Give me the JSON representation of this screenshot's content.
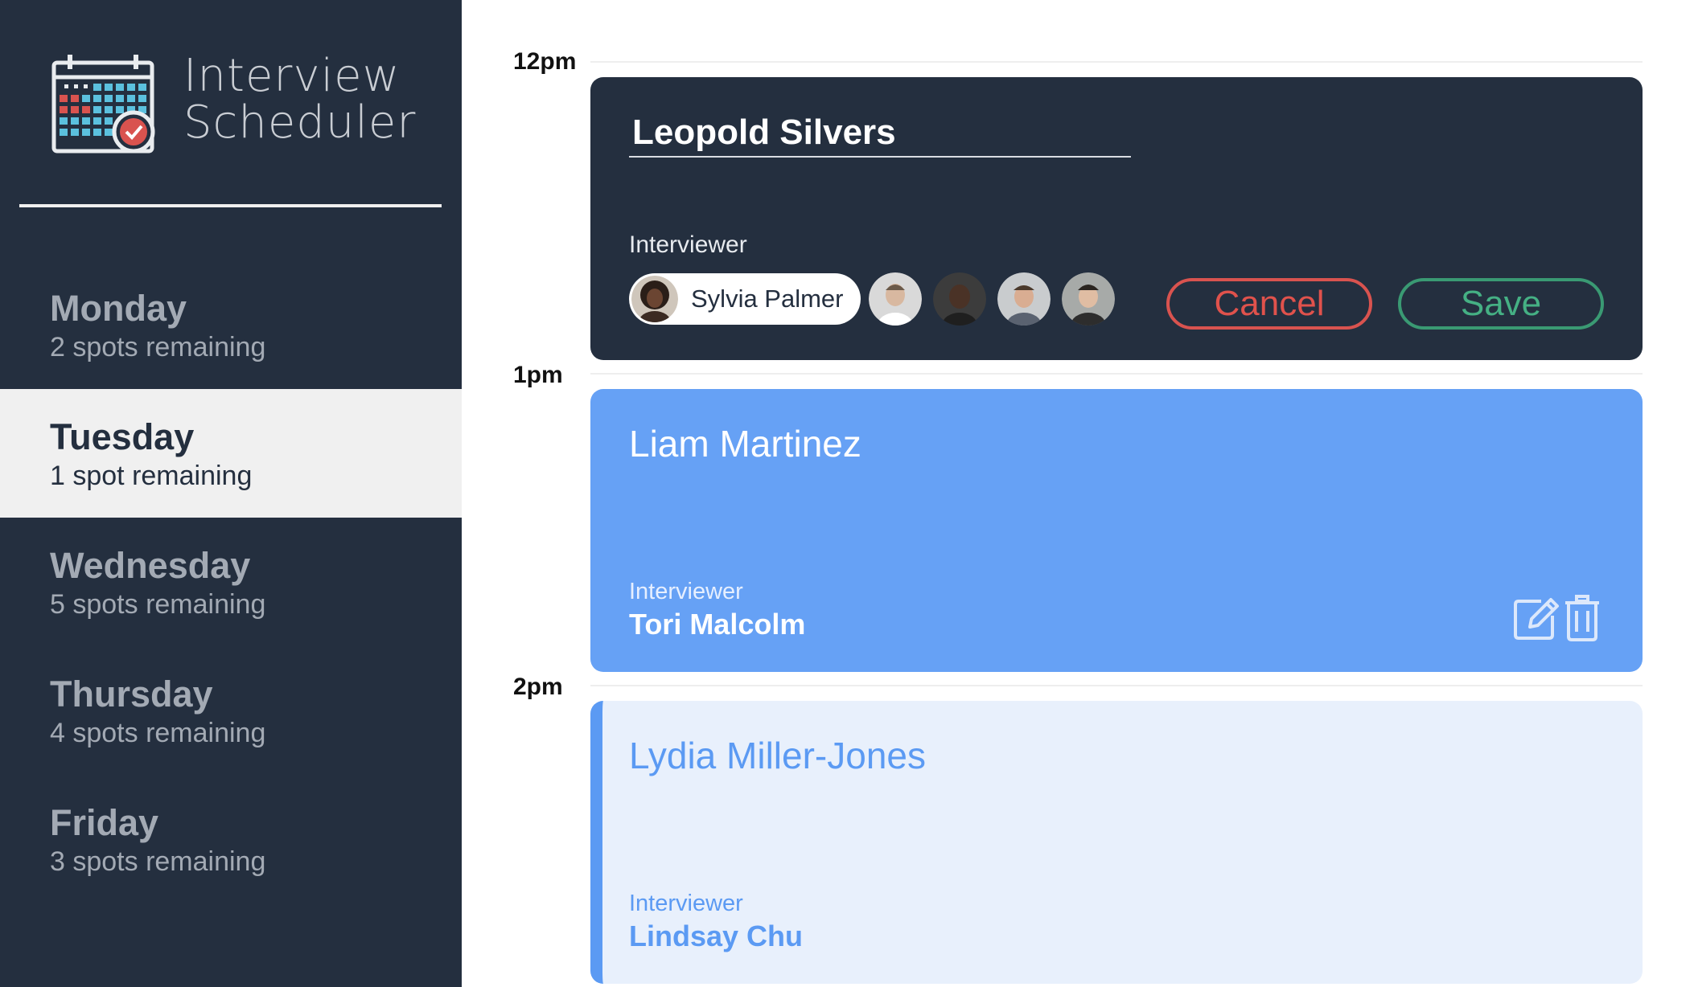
{
  "app": {
    "title_line1": "Interview",
    "title_line2": "Scheduler",
    "logo_icon": "calendar-check-icon"
  },
  "days": [
    {
      "name": "Monday",
      "spots": "2 spots remaining",
      "selected": false
    },
    {
      "name": "Tuesday",
      "spots": "1 spot remaining",
      "selected": true
    },
    {
      "name": "Wednesday",
      "spots": "5 spots remaining",
      "selected": false
    },
    {
      "name": "Thursday",
      "spots": "4 spots remaining",
      "selected": false
    },
    {
      "name": "Friday",
      "spots": "3 spots remaining",
      "selected": false
    }
  ],
  "times": [
    "12pm",
    "1pm",
    "2pm"
  ],
  "appointments": [
    {
      "mode": "edit",
      "student": "Leopold Silvers",
      "interviewer_label": "Interviewer",
      "selected_interviewer": "Sylvia Palmer",
      "other_interviewer_avatars": 4,
      "cancel_label": "Cancel",
      "save_label": "Save"
    },
    {
      "mode": "show",
      "student": "Liam Martinez",
      "interviewer_label": "Interviewer",
      "interviewer": "Tori Malcolm",
      "edit_icon": "edit-icon",
      "delete_icon": "trash-icon"
    },
    {
      "mode": "show",
      "student": "Lydia Miller-Jones",
      "interviewer_label": "Interviewer",
      "interviewer": "Lindsay Chu"
    }
  ],
  "colors": {
    "sidebar": "#242f3f",
    "selected_day": "#f0f0f0",
    "card_blue": "#66a1f5",
    "card_light": "#e8f0fc",
    "cancel": "#e0524c",
    "save": "#45b084"
  }
}
